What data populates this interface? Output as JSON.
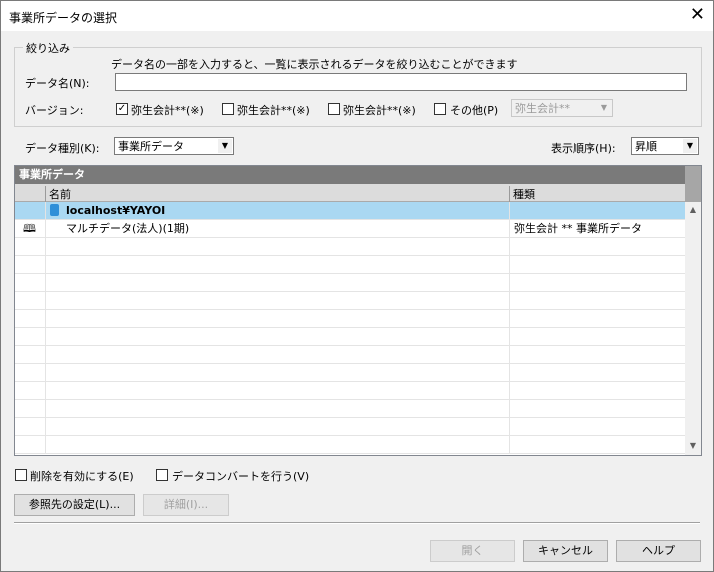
{
  "window": {
    "title": "事業所データの選択"
  },
  "filter": {
    "group_title": "絞り込み",
    "hint": "データ名の一部を入力すると、一覧に表示されるデータを絞り込むことができます",
    "data_name_label": "データ名(N):",
    "data_name_value": "",
    "version_label": "バージョン:",
    "versions": [
      {
        "label": "弥生会計**(※)",
        "checked": true
      },
      {
        "label": "弥生会計**(※)",
        "checked": false
      },
      {
        "label": "弥生会計**(※)",
        "checked": false
      },
      {
        "label": "その他(P)",
        "checked": false
      }
    ],
    "other_version_select": "弥生会計**"
  },
  "data_type": {
    "label": "データ種別(K):",
    "value": "事業所データ"
  },
  "sort": {
    "label": "表示順序(H):",
    "value": "昇順"
  },
  "list": {
    "header": "事業所データ",
    "columns": [
      "名前",
      "種類"
    ],
    "rows": [
      {
        "name": "localhost¥YAYOI",
        "type": "",
        "selected": true,
        "icon": "database-icon"
      },
      {
        "name": "マルチデータ(法人)(1期)",
        "type": "弥生会計 ** 事業所データ",
        "selected": false,
        "icon": "book-icon"
      }
    ]
  },
  "options": {
    "enable_delete": "削除を有効にする(E)",
    "data_convert": "データコンバートを行う(V)"
  },
  "buttons": {
    "reference": "参照先の設定(L)...",
    "details": "詳細(I)...",
    "open": "開く",
    "cancel": "キャンセル",
    "help": "ヘルプ"
  }
}
